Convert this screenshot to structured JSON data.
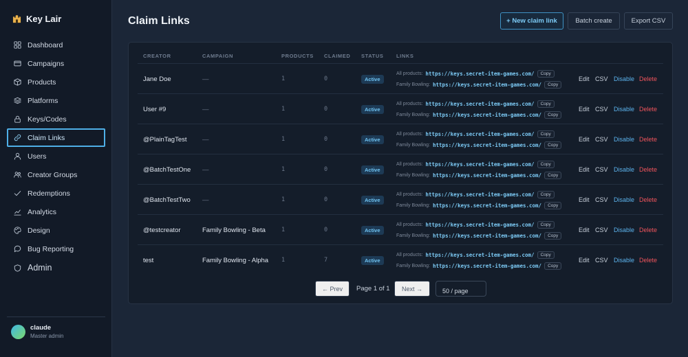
{
  "brand": {
    "name": "Key Lair"
  },
  "nav": [
    {
      "label": "Dashboard",
      "icon": "dashboard-icon"
    },
    {
      "label": "Campaigns",
      "icon": "campaigns-icon"
    },
    {
      "label": "Products",
      "icon": "box-icon"
    },
    {
      "label": "Platforms",
      "icon": "layers-icon"
    },
    {
      "label": "Keys/Codes",
      "icon": "lock-icon"
    },
    {
      "label": "Claim Links",
      "icon": "link-icon",
      "active": true
    },
    {
      "label": "Users",
      "icon": "user-icon"
    },
    {
      "label": "Creator Groups",
      "icon": "users-icon"
    },
    {
      "label": "Redemptions",
      "icon": "check-icon"
    },
    {
      "label": "Analytics",
      "icon": "chart-icon"
    },
    {
      "label": "Design",
      "icon": "palette-icon"
    },
    {
      "label": "Bug Reporting",
      "icon": "chat-icon"
    },
    {
      "label": "Admin",
      "icon": "shield-icon"
    }
  ],
  "user": {
    "name": "claude",
    "role": "Master admin"
  },
  "header": {
    "title": "Claim Links",
    "new_label": "+ New claim link",
    "batch_label": "Batch create",
    "export_label": "Export CSV"
  },
  "table": {
    "columns": [
      "CREATOR",
      "CAMPAIGN",
      "PRODUCTS",
      "CLAIMED",
      "STATUS",
      "LINKS"
    ],
    "link_labels": [
      "All products:",
      "Family Bowling:"
    ],
    "link_url": "https://keys.secret-item-games.com/",
    "copy_label": "Copy",
    "actions": {
      "edit": "Edit",
      "csv": "CSV",
      "disable": "Disable",
      "delete": "Delete"
    },
    "rows": [
      {
        "creator": "Jane Doe",
        "campaign": "—",
        "products": "1",
        "claimed": "0",
        "status": "Active"
      },
      {
        "creator": "User #9",
        "campaign": "—",
        "products": "1",
        "claimed": "0",
        "status": "Active"
      },
      {
        "creator": "@PlainTagTest",
        "campaign": "—",
        "products": "1",
        "claimed": "0",
        "status": "Active"
      },
      {
        "creator": "@BatchTestOne",
        "campaign": "—",
        "products": "1",
        "claimed": "0",
        "status": "Active"
      },
      {
        "creator": "@BatchTestTwo",
        "campaign": "—",
        "products": "1",
        "claimed": "0",
        "status": "Active"
      },
      {
        "creator": "@testcreator",
        "campaign": "Family Bowling - Beta",
        "products": "1",
        "claimed": "0",
        "status": "Active"
      },
      {
        "creator": "test",
        "campaign": "Family Bowling - Alpha",
        "products": "1",
        "claimed": "7",
        "status": "Active"
      }
    ]
  },
  "pagination": {
    "prev_label": "← Prev",
    "info": "Page 1 of 1",
    "next_label": "Next →",
    "page_size": "50 / page"
  }
}
